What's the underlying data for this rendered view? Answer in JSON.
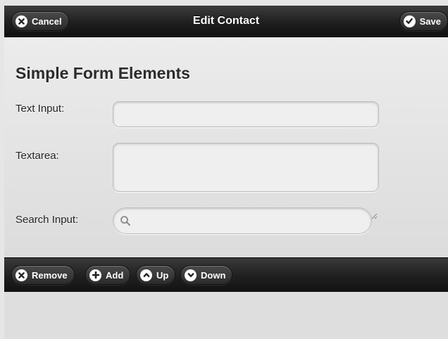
{
  "header": {
    "title": "Edit Contact",
    "cancel_label": "Cancel",
    "save_label": "Save"
  },
  "form": {
    "title": "Simple Form Elements",
    "text_input": {
      "label": "Text Input:",
      "value": "",
      "placeholder": ""
    },
    "textarea": {
      "label": "Textarea:",
      "value": "",
      "placeholder": ""
    },
    "search_input": {
      "label": "Search Input:",
      "value": "",
      "placeholder": ""
    }
  },
  "footer": {
    "buttons": [
      {
        "label": "Remove",
        "icon": "close-icon"
      },
      {
        "label": "Add",
        "icon": "plus-icon"
      },
      {
        "label": "Up",
        "icon": "chevron-up-icon"
      },
      {
        "label": "Down",
        "icon": "chevron-down-icon"
      }
    ]
  },
  "colors": {
    "bar_dark": "#1f1f1f",
    "content_bg": "#e6e6e6",
    "field_bg": "#efefef",
    "text": "#2b2b2b"
  }
}
